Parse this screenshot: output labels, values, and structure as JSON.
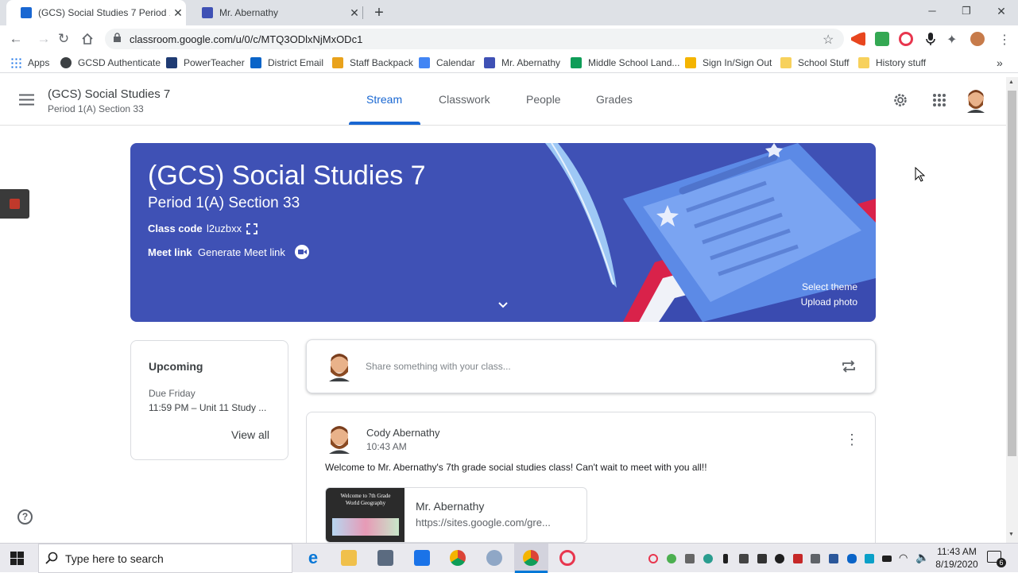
{
  "browser": {
    "tabs": [
      {
        "title": "(GCS) Social Studies 7 Period 1(A",
        "active": true,
        "favicon_color": "#1967d2"
      },
      {
        "title": "Mr. Abernathy",
        "active": false,
        "favicon_color": "#3f51b5"
      }
    ],
    "new_tab_label": "+",
    "window_controls": {
      "minimize": "─",
      "maximize": "❐",
      "close": "✕"
    },
    "url": "classroom.google.com/u/0/c/MTQ3ODlxNjMxODc1",
    "bookmarks": [
      {
        "label": "Apps",
        "icon": "apps-grid-icon",
        "color": "#1a73e8"
      },
      {
        "label": "GCSD Authenticate",
        "icon": "gear-badge-icon",
        "color": "#3c4043"
      },
      {
        "label": "PowerTeacher",
        "icon": "powerteacher-icon",
        "color": "#1f3b73"
      },
      {
        "label": "District Email",
        "icon": "outlook-icon",
        "color": "#0a64c8"
      },
      {
        "label": "Staff Backpack",
        "icon": "backpack-icon",
        "color": "#e9a21b"
      },
      {
        "label": "Calendar",
        "icon": "calendar-icon",
        "color": "#4285f4"
      },
      {
        "label": "Mr. Abernathy",
        "icon": "sites-icon",
        "color": "#3f51b5"
      },
      {
        "label": "Middle School Land...",
        "icon": "sheets-icon",
        "color": "#0f9d58"
      },
      {
        "label": "Sign In/Sign Out",
        "icon": "form-icon",
        "color": "#f4b400"
      },
      {
        "label": "School Stuff",
        "icon": "folder-icon",
        "color": "#f7d15c"
      },
      {
        "label": "History stuff",
        "icon": "folder-icon",
        "color": "#f7d15c"
      }
    ],
    "bookmarks_overflow": "»"
  },
  "classroom": {
    "header": {
      "course_title": "(GCS) Social Studies 7",
      "course_subtitle": "Period 1(A) Section 33",
      "tabs": [
        {
          "label": "Stream",
          "active": true
        },
        {
          "label": "Classwork",
          "active": false
        },
        {
          "label": "People",
          "active": false
        },
        {
          "label": "Grades",
          "active": false
        }
      ]
    },
    "banner": {
      "title": "(GCS) Social Studies 7",
      "subtitle": "Period 1(A) Section 33",
      "class_code_label": "Class code",
      "class_code": "l2uzbxx",
      "meet_link_label": "Meet link",
      "meet_link_action": "Generate Meet link",
      "select_theme": "Select theme",
      "upload_photo": "Upload photo",
      "color": "#3f51b5"
    },
    "upcoming": {
      "heading": "Upcoming",
      "due_label": "Due Friday",
      "item": "11:59 PM – Unit 11 Study ...",
      "view_all": "View all"
    },
    "share": {
      "placeholder": "Share something with your class..."
    },
    "post": {
      "author": "Cody Abernathy",
      "time": "10:43 AM",
      "body": "Welcome to Mr. Abernathy's 7th grade social studies class! Can't wait to meet with you all!!",
      "attachment": {
        "title": "Mr. Abernathy",
        "url": "https://sites.google.com/gre...",
        "thumb_heading": "Welcome to 7th Grade World Geography"
      }
    }
  },
  "taskbar": {
    "search_placeholder": "Type here to search",
    "time": "11:43 AM",
    "date": "8/19/2020",
    "notification_count": "6"
  }
}
